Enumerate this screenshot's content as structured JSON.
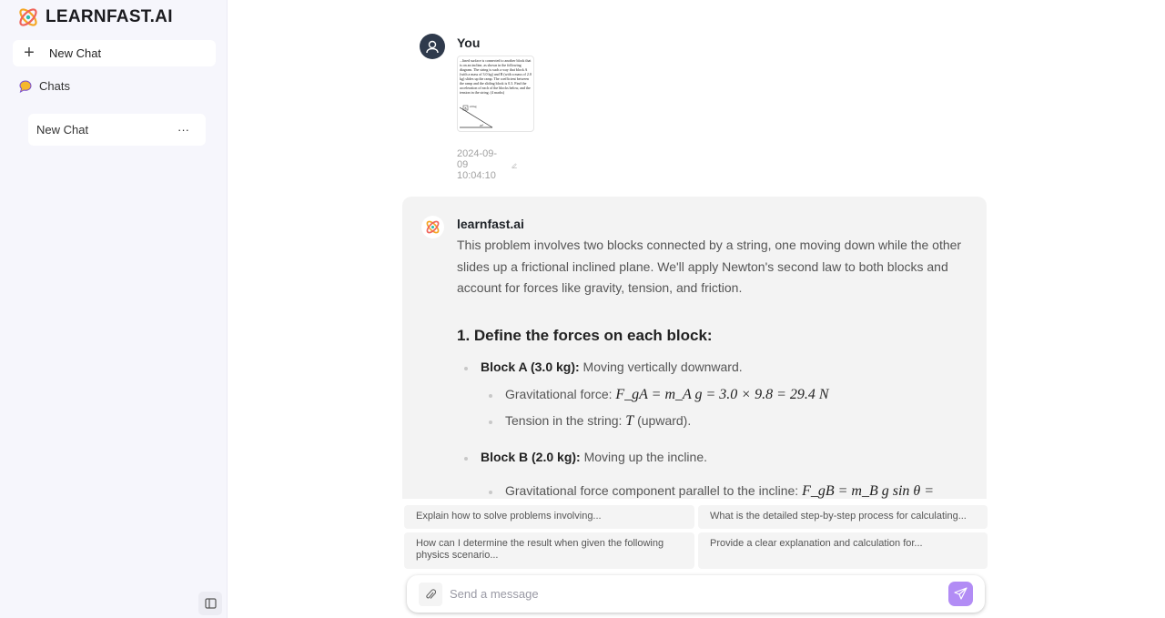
{
  "brand": {
    "name": "LEARNFAST.AI"
  },
  "sidebar": {
    "new_chat": "New Chat",
    "chats_label": "Chats",
    "items": [
      {
        "label": "New Chat",
        "menu": "···"
      }
    ]
  },
  "user_message": {
    "author": "You",
    "timestamp": "2024-09-09 10:04:10",
    "attachment_text": "...lined surface is connected to another block that is on an incline, as shown in the following diagram. The string is such a way that block A (with a mass of 3.0 kg) and B (with a mass of 2.0 kg) slides up the ramp. The coefficient between the ramp and the sliding block is 0.3. Find the acceleration of each of the blocks below, and the tension in the string. (4 marks)",
    "attachment_labels": [
      "2.0 kg",
      "B",
      "25°"
    ]
  },
  "bot_message": {
    "author": "learnfast.ai",
    "intro": "This problem involves two blocks connected by a string, one moving down while the other slides up a frictional inclined plane. We'll apply Newton's second law to both blocks and account for forces like gravity, tension, and friction.",
    "heading": "1. Define the forces on each block:",
    "block_a": {
      "label": "Block A (3.0 kg):",
      "text": " Moving vertically downward.",
      "items": [
        {
          "text": "Gravitational force: ",
          "math": "F_gA = m_A g = 3.0 × 9.8 = 29.4 N"
        },
        {
          "text": "Tension in the string: ",
          "math": "T",
          "suffix": " (upward)."
        }
      ]
    },
    "block_b": {
      "label": "Block B (2.0 kg):",
      "text": " Moving up the incline.",
      "items": [
        {
          "text": "Gravitational force component parallel to the incline: ",
          "math": "F_gB = m_B g sin θ ="
        }
      ]
    }
  },
  "suggestions": [
    "Explain how to solve problems involving...",
    "What is the detailed step-by-step process for calculating...",
    "How can I determine the result when given the following physics scenario...",
    "Provide a clear explanation and calculation for..."
  ],
  "composer": {
    "placeholder": "Send a message"
  },
  "colors": {
    "accent": "#b28cf5",
    "avatar": "#2f3a4c",
    "sidebar_bg": "#f6f6fc"
  }
}
